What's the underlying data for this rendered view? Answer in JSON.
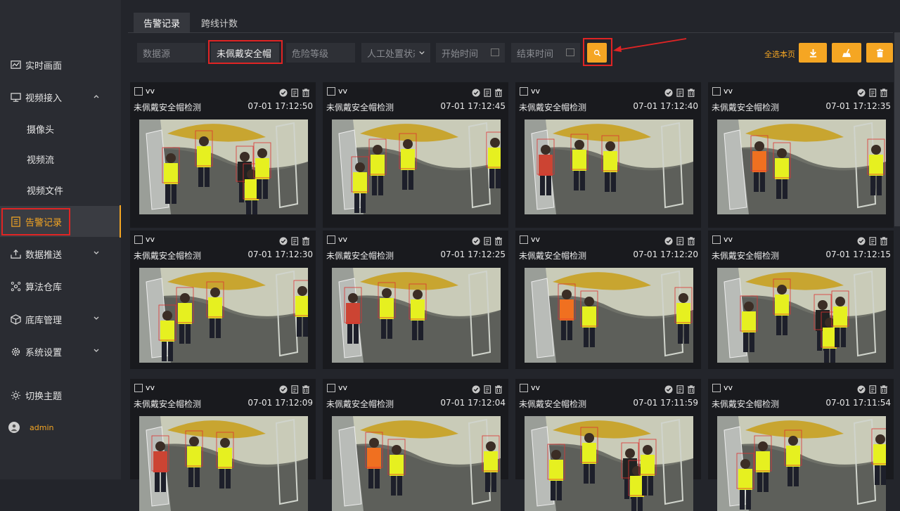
{
  "sidebar": {
    "items": [
      {
        "label": "实时画面",
        "icon": "chart-line-icon"
      },
      {
        "label": "视频接入",
        "icon": "monitor-icon"
      },
      {
        "label": "告警记录",
        "icon": "document-list-icon"
      },
      {
        "label": "数据推送",
        "icon": "upload-tray-icon"
      },
      {
        "label": "算法仓库",
        "icon": "network-icon"
      },
      {
        "label": "底库管理",
        "icon": "cube-icon"
      },
      {
        "label": "系统设置",
        "icon": "gear-icon"
      },
      {
        "label": "切换主题",
        "icon": "sun-icon"
      }
    ],
    "subitems": [
      "摄像头",
      "视频流",
      "视频文件"
    ],
    "user": "admin"
  },
  "tabs": [
    "告警记录",
    "跨线计数"
  ],
  "filters": {
    "source_placeholder": "数据源",
    "keyword_value": "未佩戴安全帽",
    "level_placeholder": "危险等级",
    "status_placeholder": "人工处置状态",
    "start_placeholder": "开始时间",
    "end_placeholder": "结束时间"
  },
  "toolbar": {
    "select_all": "全选本页"
  },
  "colors": {
    "accent": "#f5a623",
    "highlight": "#e02424"
  },
  "cards": [
    {
      "source": "vv",
      "title": "未佩戴安全帽检测",
      "time": "07-01 17:12:50"
    },
    {
      "source": "vv",
      "title": "未佩戴安全帽检测",
      "time": "07-01 17:12:45"
    },
    {
      "source": "vv",
      "title": "未佩戴安全帽检测",
      "time": "07-01 17:12:40"
    },
    {
      "source": "vv",
      "title": "未佩戴安全帽检测",
      "time": "07-01 17:12:35"
    },
    {
      "source": "vv",
      "title": "未佩戴安全帽检测",
      "time": "07-01 17:12:30"
    },
    {
      "source": "vv",
      "title": "未佩戴安全帽检测",
      "time": "07-01 17:12:25"
    },
    {
      "source": "vv",
      "title": "未佩戴安全帽检测",
      "time": "07-01 17:12:20"
    },
    {
      "source": "vv",
      "title": "未佩戴安全帽检测",
      "time": "07-01 17:12:15"
    },
    {
      "source": "vv",
      "title": "未佩戴安全帽检测",
      "time": "07-01 17:12:09"
    },
    {
      "source": "vv",
      "title": "未佩戴安全帽检测",
      "time": "07-01 17:12:04"
    },
    {
      "source": "vv",
      "title": "未佩戴安全帽检测",
      "time": "07-01 17:11:59"
    },
    {
      "source": "vv",
      "title": "未佩戴安全帽检测",
      "time": "07-01 17:11:54"
    }
  ]
}
